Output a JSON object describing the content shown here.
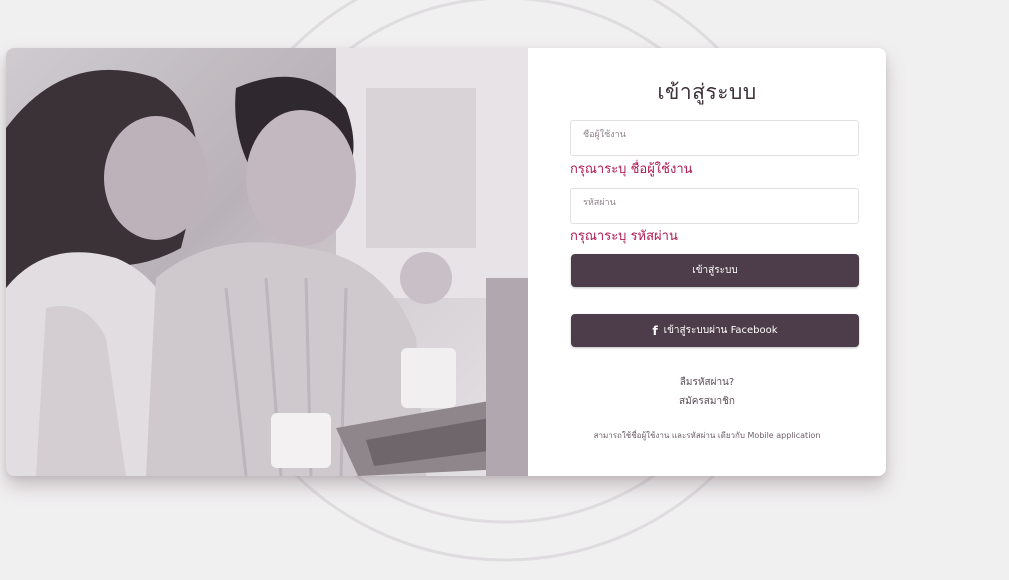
{
  "login": {
    "title": "เข้าสู่ระบบ",
    "username": {
      "placeholder": "ชื่อผู้ใช้งาน",
      "value": "",
      "error": "กรุณาระบุ ชื่อผู้ใช้งาน"
    },
    "password": {
      "placeholder": "รหัสผ่าน",
      "value": "",
      "error": "กรุณาระบุ รหัสผ่าน"
    },
    "submit_label": "เข้าสู่ระบบ",
    "facebook_label": "เข้าสู่ระบบผ่าน Facebook",
    "facebook_icon": "facebook-icon",
    "forgot_password": "ลืมรหัสผ่าน?",
    "register": "สมัครสมาชิก",
    "mobile_note": "สามารถใช้ชื่อผู้ใช้งาน และรหัสผ่าน เดียวกับ Mobile application"
  },
  "colors": {
    "button": "#4d3c49",
    "error": "#b01a52",
    "background": "#f1f0f1"
  }
}
